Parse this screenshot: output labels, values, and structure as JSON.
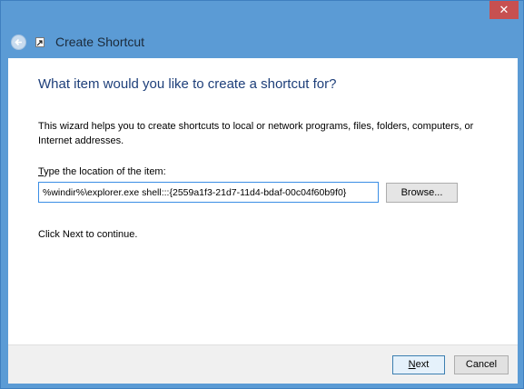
{
  "window": {
    "close_glyph": "✕"
  },
  "header": {
    "title": "Create Shortcut",
    "back_icon": "back-arrow-icon",
    "app_icon": "shortcut-icon"
  },
  "main": {
    "heading": "What item would you like to create a shortcut for?",
    "description": "This wizard helps you to create shortcuts to local or network programs, files, folders, computers, or Internet addresses.",
    "field_label_accel": "T",
    "field_label_rest": "ype the location of the item:",
    "location_value": "%windir%\\explorer.exe shell:::{2559a1f3-21d7-11d4-bdaf-00c04f60b9f0}",
    "browse_label": "Browse...",
    "continue_text": "Click Next to continue."
  },
  "footer": {
    "next_accel": "N",
    "next_rest": "ext",
    "cancel_label": "Cancel"
  },
  "colors": {
    "frame": "#5b9bd5",
    "close": "#c75050",
    "heading": "#1e3f7a",
    "input_border": "#3b8ee5"
  }
}
